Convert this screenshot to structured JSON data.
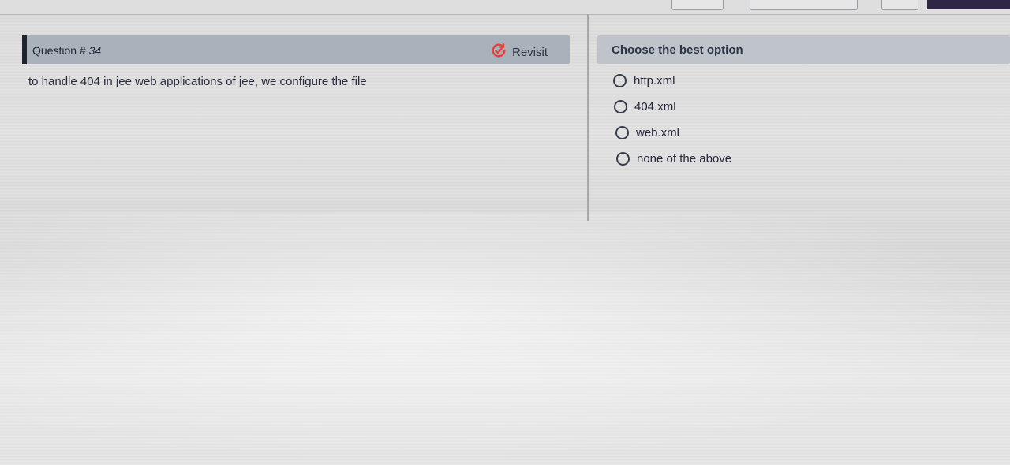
{
  "question": {
    "title_prefix": "Question # ",
    "number": "34",
    "revisit_label": "Revisit",
    "text": "to handle 404 in jee web applications of jee, we configure the file"
  },
  "answers": {
    "header": "Choose the best option",
    "options": [
      "http.xml",
      "404.xml",
      "web.xml",
      "none of the above"
    ]
  },
  "colors": {
    "header_bg": "#a9b1ba",
    "accent": "#1f2430",
    "revisit_icon": "#e8413a"
  },
  "icons": {
    "revisit": "revisit-icon",
    "radio": "radio-icon"
  }
}
